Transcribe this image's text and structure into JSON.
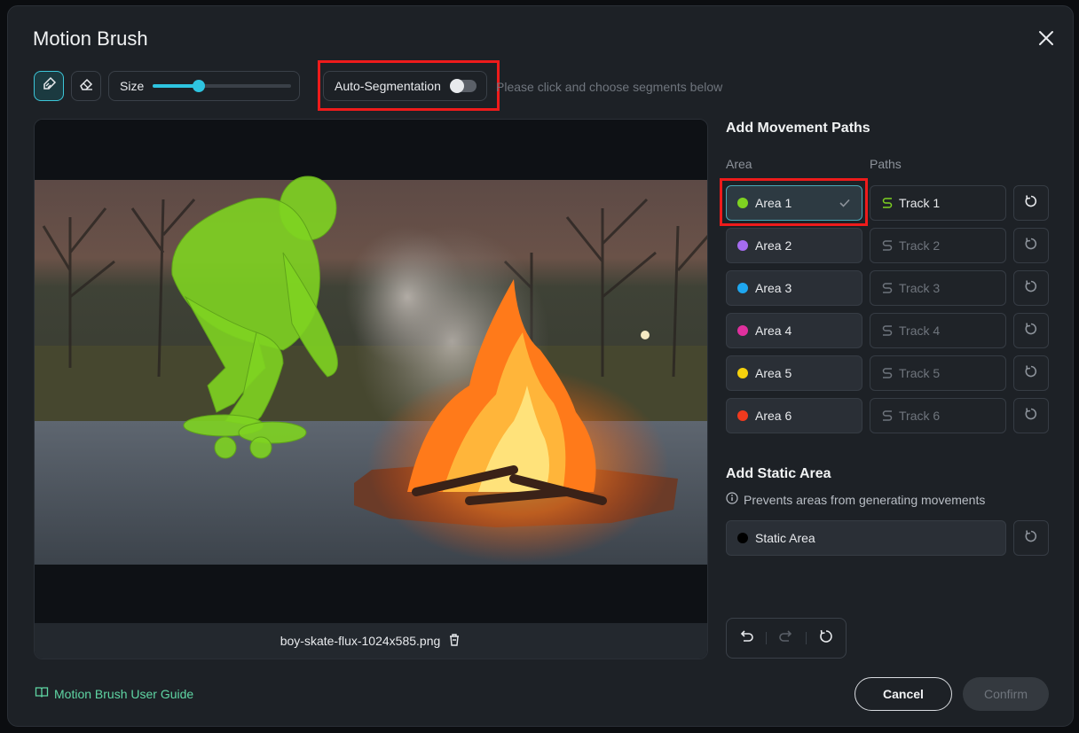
{
  "dialog": {
    "title": "Motion Brush",
    "close_icon": "close-icon"
  },
  "toolbar": {
    "brush_icon": "brush-icon",
    "eraser_icon": "eraser-icon",
    "size_label": "Size",
    "size_value": 0.33,
    "auto_segmentation_label": "Auto-Segmentation",
    "auto_segmentation_on": false,
    "hint": "Please click and choose segments below"
  },
  "canvas": {
    "file_name": "boy-skate-flux-1024x585.png",
    "delete_icon": "trash-icon"
  },
  "movement": {
    "title": "Add Movement Paths",
    "area_header": "Area",
    "paths_header": "Paths",
    "rows": [
      {
        "area": "Area 1",
        "color": "#7ed321",
        "track": "Track 1",
        "selected": true
      },
      {
        "area": "Area 2",
        "color": "#a56cf0",
        "track": "Track 2",
        "selected": false
      },
      {
        "area": "Area 3",
        "color": "#1ea7f0",
        "track": "Track 3",
        "selected": false
      },
      {
        "area": "Area 4",
        "color": "#e0309e",
        "track": "Track 4",
        "selected": false
      },
      {
        "area": "Area 5",
        "color": "#f5d10c",
        "track": "Track 5",
        "selected": false
      },
      {
        "area": "Area 6",
        "color": "#f03a1e",
        "track": "Track 6",
        "selected": false
      }
    ]
  },
  "static": {
    "title": "Add Static Area",
    "hint": "Prevents areas from generating movements",
    "button": "Static Area",
    "color": "#000000"
  },
  "footer": {
    "guide": "Motion Brush User Guide",
    "cancel": "Cancel",
    "confirm": "Confirm"
  },
  "colors": {
    "accent": "#2ec4e0",
    "highlight": "#ee1b1b",
    "guide": "#5fd6a4"
  }
}
